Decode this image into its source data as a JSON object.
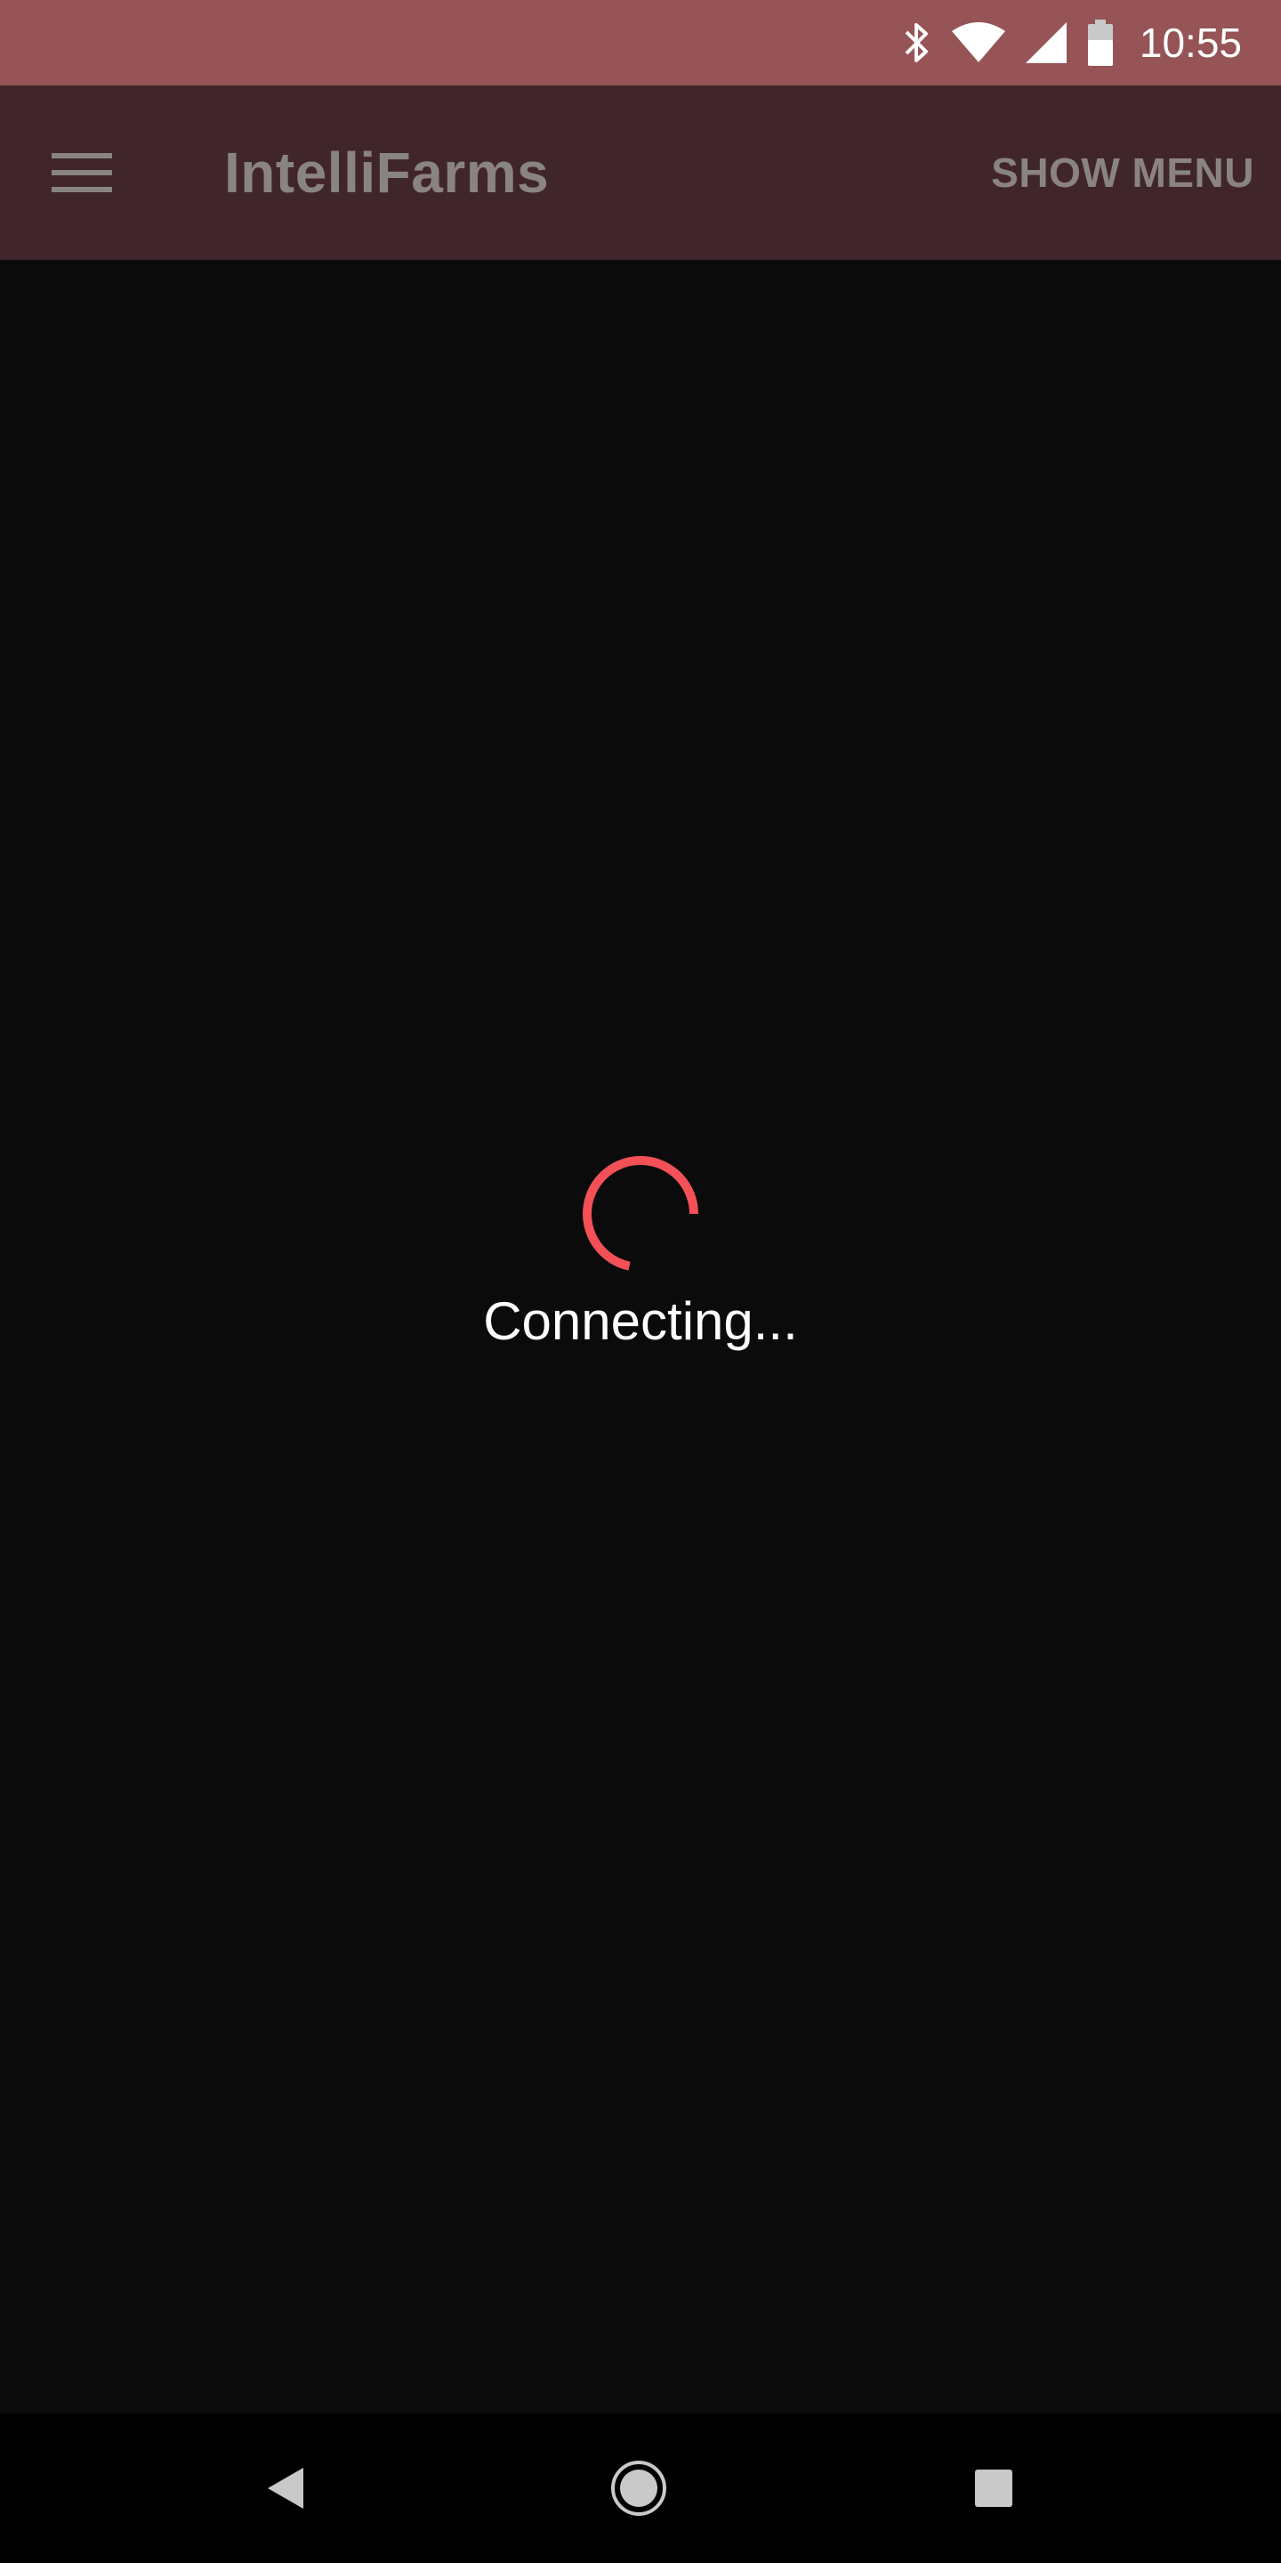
{
  "status_bar": {
    "time": "10:55",
    "icons": [
      "bluetooth-icon",
      "wifi-icon",
      "cell-signal-icon",
      "battery-icon"
    ],
    "background_color": "#965457"
  },
  "app_bar": {
    "title": "IntelliFarms",
    "action_label": "SHOW MENU",
    "menu_icon": "hamburger-menu-icon",
    "background_color": "#40262a"
  },
  "main": {
    "loading_text": "Connecting...",
    "spinner_color": "#f45058"
  },
  "nav_bar": {
    "icons": [
      "back-icon",
      "home-icon",
      "recents-icon"
    ]
  }
}
